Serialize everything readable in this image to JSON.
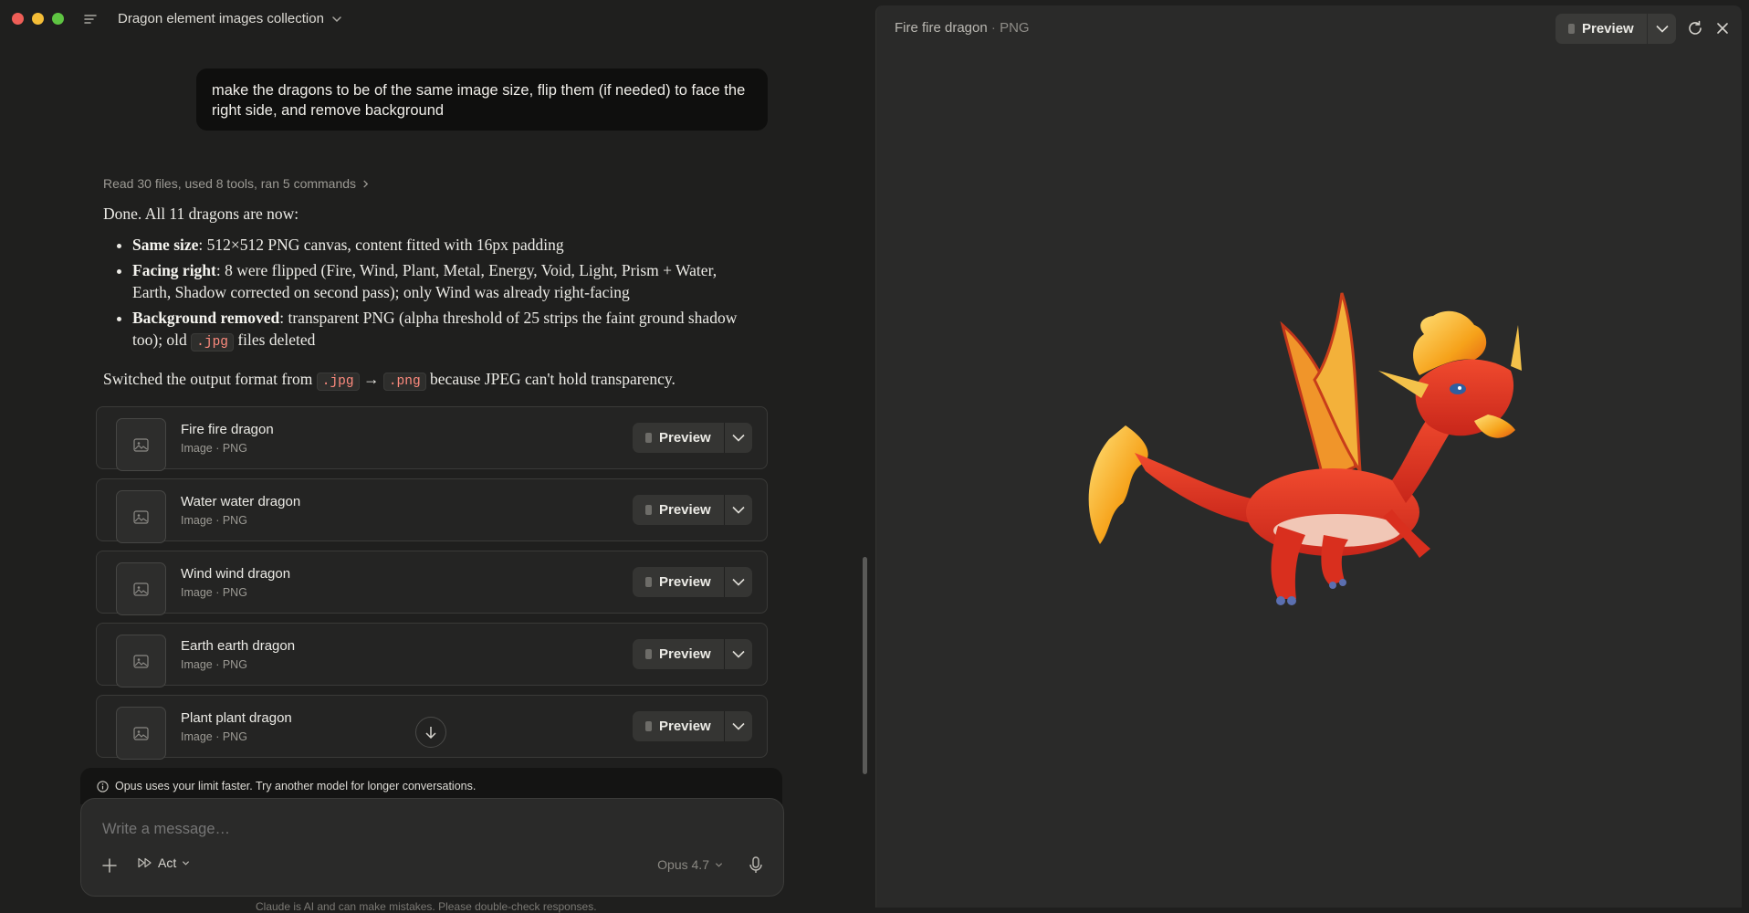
{
  "window": {
    "chat_title": "Dragon element images collection"
  },
  "chat": {
    "user_message": "make the dragons to be of the same image size, flip them (if needed) to face the right side, and remove background",
    "tools_summary": "Read 30 files, used 8 tools, ran 5 commands",
    "reply": {
      "intro": "Done. All 11 dragons are now:",
      "bullets": [
        {
          "bold": "Same size",
          "text": ": 512×512 PNG canvas, content fitted with 16px padding"
        },
        {
          "bold": "Facing right",
          "text": ": 8 were flipped (Fire, Wind, Plant, Metal, Energy, Void, Light, Prism + Water, Earth, Shadow corrected on second pass); only Wind was already right-facing"
        },
        {
          "bold": "Background removed",
          "text_before": ": transparent PNG (alpha threshold of 25 strips the faint ground shadow too); old ",
          "code": ".jpg",
          "text_after": " files deleted"
        }
      ],
      "switched_before": "Switched the output format from ",
      "switched_code1": ".jpg",
      "switched_arrow": " → ",
      "switched_code2": ".png",
      "switched_after": " because JPEG can't hold transparency."
    },
    "files": [
      {
        "name": "Fire fire dragon",
        "meta": "Image · PNG",
        "preview_label": "Preview"
      },
      {
        "name": "Water water dragon",
        "meta": "Image · PNG",
        "preview_label": "Preview"
      },
      {
        "name": "Wind wind dragon",
        "meta": "Image · PNG",
        "preview_label": "Preview"
      },
      {
        "name": "Earth earth dragon",
        "meta": "Image · PNG",
        "preview_label": "Preview"
      },
      {
        "name": "Plant plant dragon",
        "meta": "Image · PNG",
        "preview_label": "Preview"
      }
    ]
  },
  "composer": {
    "notice": "Opus uses your limit faster. Try another model for longer conversations.",
    "placeholder": "Write a message…",
    "mode_label": "Act",
    "model_label": "Opus 4.7",
    "footer_text": "Claude is AI and can make mistakes. Please double-check responses."
  },
  "preview_pane": {
    "file_name": "Fire fire dragon",
    "separator": "·",
    "file_type": "PNG",
    "preview_label": "Preview"
  },
  "icons": {
    "sidebar": "menu-icon",
    "thumb": "image-icon",
    "refresh": "refresh-icon",
    "close": "close-icon",
    "mic": "mic-icon"
  },
  "colors": {
    "background": "#1f1f1e",
    "preview_pane": "#2a2a29",
    "code_text": "#ff8b7e",
    "traffic_red": "#ee5e57",
    "traffic_yellow": "#f4bd37",
    "traffic_green": "#5ec442"
  }
}
